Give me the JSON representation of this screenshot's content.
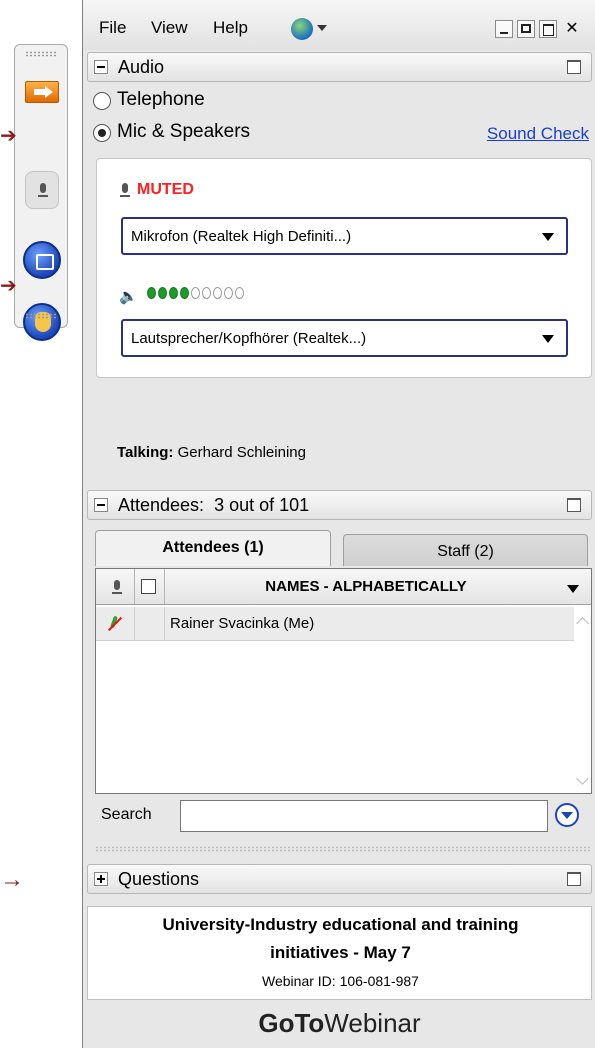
{
  "menu": {
    "file": "File",
    "view": "View",
    "help": "Help"
  },
  "audio": {
    "header": "Audio",
    "telephone_label": "Telephone",
    "mic_speakers_label": "Mic & Speakers",
    "sound_check": "Sound Check",
    "muted_label": "MUTED",
    "microphone_device": "Mikrofon (Realtek High Definiti...)",
    "speaker_device": "Lautsprecher/Kopfhörer (Realtek...)",
    "speaker_level": {
      "filled": 4,
      "total": 9
    },
    "talking_label": "Talking:",
    "talking_name": "Gerhard Schleining"
  },
  "attendees": {
    "header": "Attendees:  3 out of 101",
    "tab_attendees": "Attendees (1)",
    "tab_staff": "Staff (2)",
    "column_names": "NAMES - ALPHABETICALLY",
    "rows": [
      {
        "name": "Rainer Svacinka (Me)"
      }
    ],
    "search_label": "Search",
    "search_value": ""
  },
  "questions": {
    "header": "Questions"
  },
  "webinar": {
    "title_line1": "University-Industry educational and training",
    "title_line2": "initiatives - May 7",
    "id": "Webinar ID: 106-081-987"
  },
  "brand": {
    "part1": "GoTo",
    "part2": "Webinar"
  },
  "colors": {
    "muted": "#ff2020",
    "link": "#1a3fd0",
    "level_on": "#1e9a2d",
    "accent_arrow": "#8b1a1a"
  }
}
